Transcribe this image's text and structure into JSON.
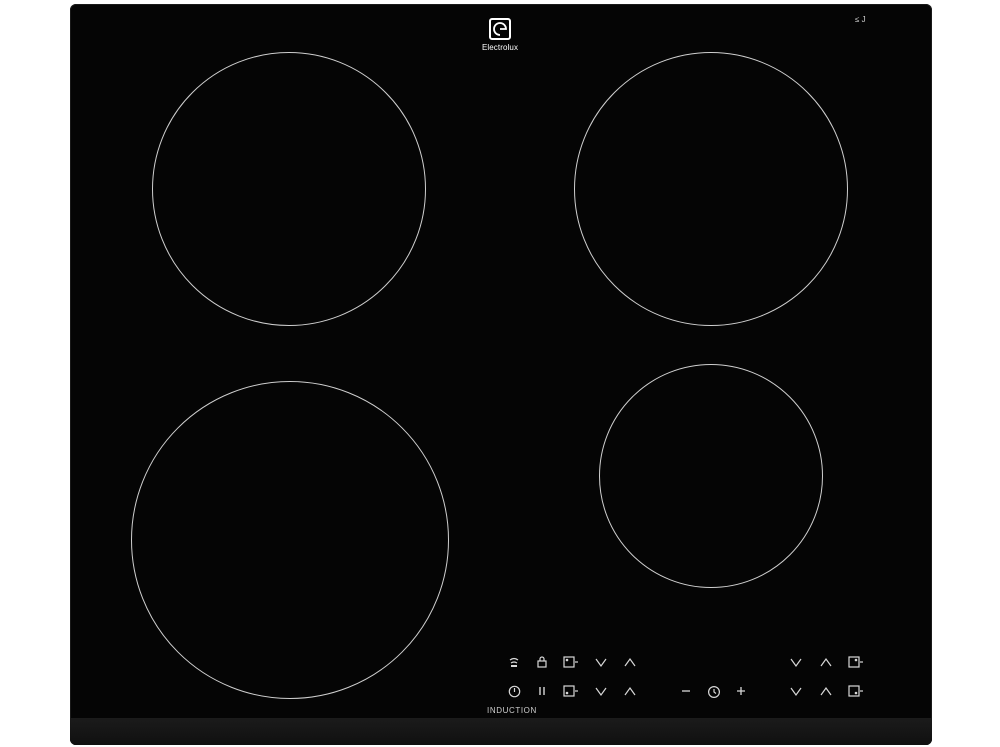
{
  "brand": {
    "name": "Electrolux"
  },
  "corner_mark": "≤ J",
  "panel": {
    "label": "INDUCTION"
  },
  "colors": {
    "glass": "#050505",
    "zone_outline": "#cfcfcf",
    "symbols": "#d8d8d8"
  }
}
